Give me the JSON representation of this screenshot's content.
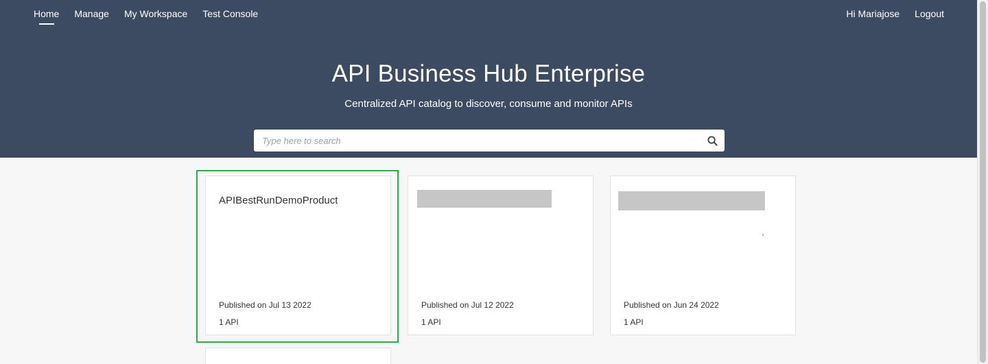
{
  "nav": {
    "left": [
      {
        "label": "Home",
        "active": true
      },
      {
        "label": "Manage",
        "active": false
      },
      {
        "label": "My Workspace",
        "active": false
      },
      {
        "label": "Test Console",
        "active": false
      }
    ],
    "greeting": "Hi Mariajose",
    "logout_label": "Logout"
  },
  "hero": {
    "title": "API Business Hub Enterprise",
    "subtitle": "Centralized API catalog to discover, consume and monitor APIs"
  },
  "search": {
    "placeholder": "Type here to search",
    "value": "",
    "icon": "search-icon"
  },
  "cards": [
    {
      "title": "APIBestRunDemoProduct",
      "published": "Published on Jul 13 2022",
      "count": "1 API",
      "title_redacted": false,
      "selected": true
    },
    {
      "title": "",
      "published": "Published on Jul 12 2022",
      "count": "1 API",
      "title_redacted": true,
      "selected": false
    },
    {
      "title": "",
      "published": "Published on Jun 24 2022",
      "count": "1 API",
      "title_redacted": true,
      "selected": false
    }
  ],
  "colors": {
    "header_bg": "#3c4a62",
    "page_bg": "#f7f7f7",
    "selection": "#2ea84a",
    "redaction": "#c6c6c6"
  }
}
